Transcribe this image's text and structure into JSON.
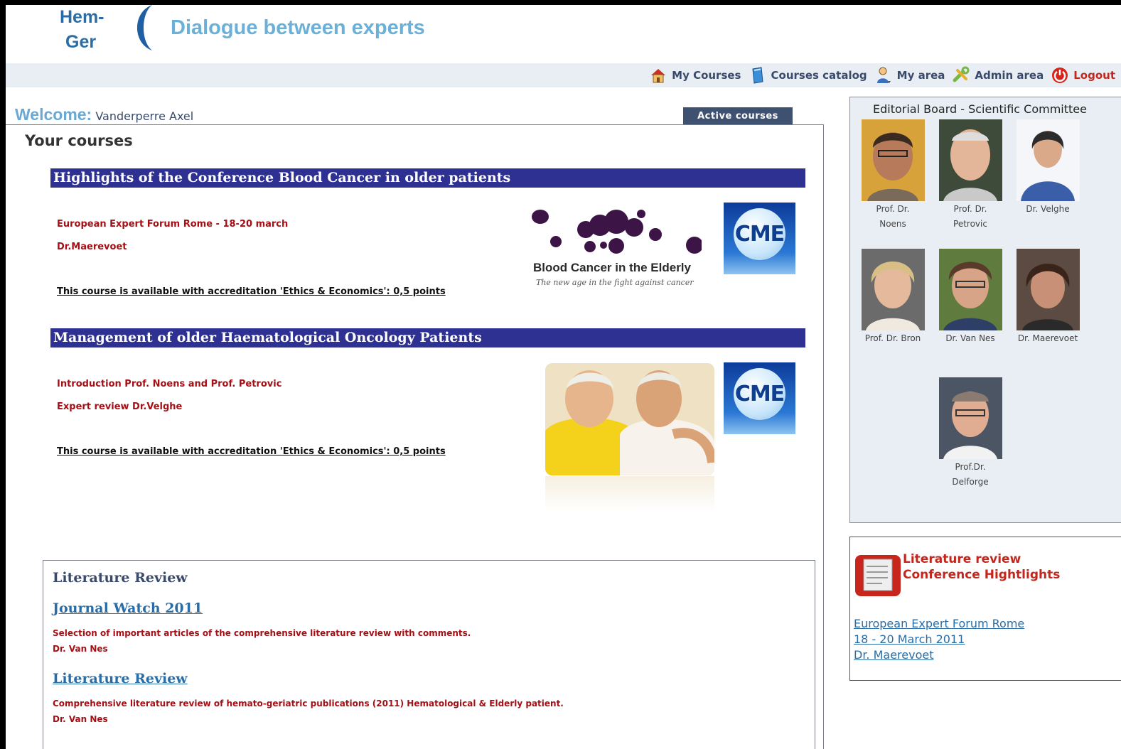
{
  "header": {
    "logo_line1": "Hem-",
    "logo_line2": "Ger",
    "tagline": "Dialogue between experts"
  },
  "nav": {
    "items": [
      {
        "label": "My Courses",
        "icon": "home-icon"
      },
      {
        "label": "Courses catalog",
        "icon": "book-icon"
      },
      {
        "label": "My area",
        "icon": "user-icon"
      },
      {
        "label": "Admin area",
        "icon": "tools-icon"
      },
      {
        "label": "Logout",
        "icon": "power-icon"
      }
    ]
  },
  "welcome": {
    "label": "Welcome:",
    "user": "Vanderperre Axel"
  },
  "tabs": {
    "active": "Active courses"
  },
  "main": {
    "heading": "Your courses",
    "courses": [
      {
        "title": "Highlights of the Conference Blood Cancer in older patients",
        "lines": [
          "European Expert Forum Rome - 18-20 march",
          "Dr.Maerevoet"
        ],
        "accreditation": "This course is available with accreditation 'Ethics & Economics': 0,5 points",
        "badge": "CME",
        "image_title": "Blood Cancer in the Elderly",
        "image_subtitle": "The new age in the fight against cancer"
      },
      {
        "title": "Management of older Haematological Oncology Patients",
        "lines": [
          "Introduction Prof. Noens and Prof. Petrovic",
          "Expert review Dr.Velghe"
        ],
        "accreditation": "This course is available with accreditation 'Ethics & Economics': 0,5 points",
        "badge": "CME"
      }
    ]
  },
  "literature": {
    "heading": "Literature Review",
    "entries": [
      {
        "link": "Journal Watch 2011",
        "description": "Selection of important articles of the comprehensive literature review with comments.",
        "author": "Dr. Van Nes"
      },
      {
        "link": "Literature Review",
        "description": "Comprehensive literature review of hemato-geriatric publications (2011) Hematological & Elderly patient.",
        "author": "Dr. Van Nes"
      }
    ]
  },
  "sidebar": {
    "board_title": "Editorial Board - Scientific Committee",
    "members": [
      {
        "line1": "Prof. Dr.",
        "line2": "Noens"
      },
      {
        "line1": "Prof. Dr.",
        "line2": "Petrovic"
      },
      {
        "line1": "Dr. Velghe",
        "line2": ""
      },
      {
        "line1": "Prof. Dr. Bron",
        "line2": ""
      },
      {
        "line1": "Dr. Van Nes",
        "line2": ""
      },
      {
        "line1": "Dr. Maerevoet",
        "line2": ""
      },
      {
        "line1": "Prof.Dr.",
        "line2": "Delforge"
      }
    ],
    "litrev": {
      "title1": "Literature review",
      "title2": "Conference Hightlights",
      "links": [
        "European Expert Forum Rome",
        "18 - 20 March 2011",
        "Dr. Maerevoet"
      ]
    }
  },
  "colors": {
    "course_bar": "#2e3192",
    "accent_red": "#a50f15",
    "link_blue": "#2a6da6",
    "tab_dark": "#3f5170"
  }
}
